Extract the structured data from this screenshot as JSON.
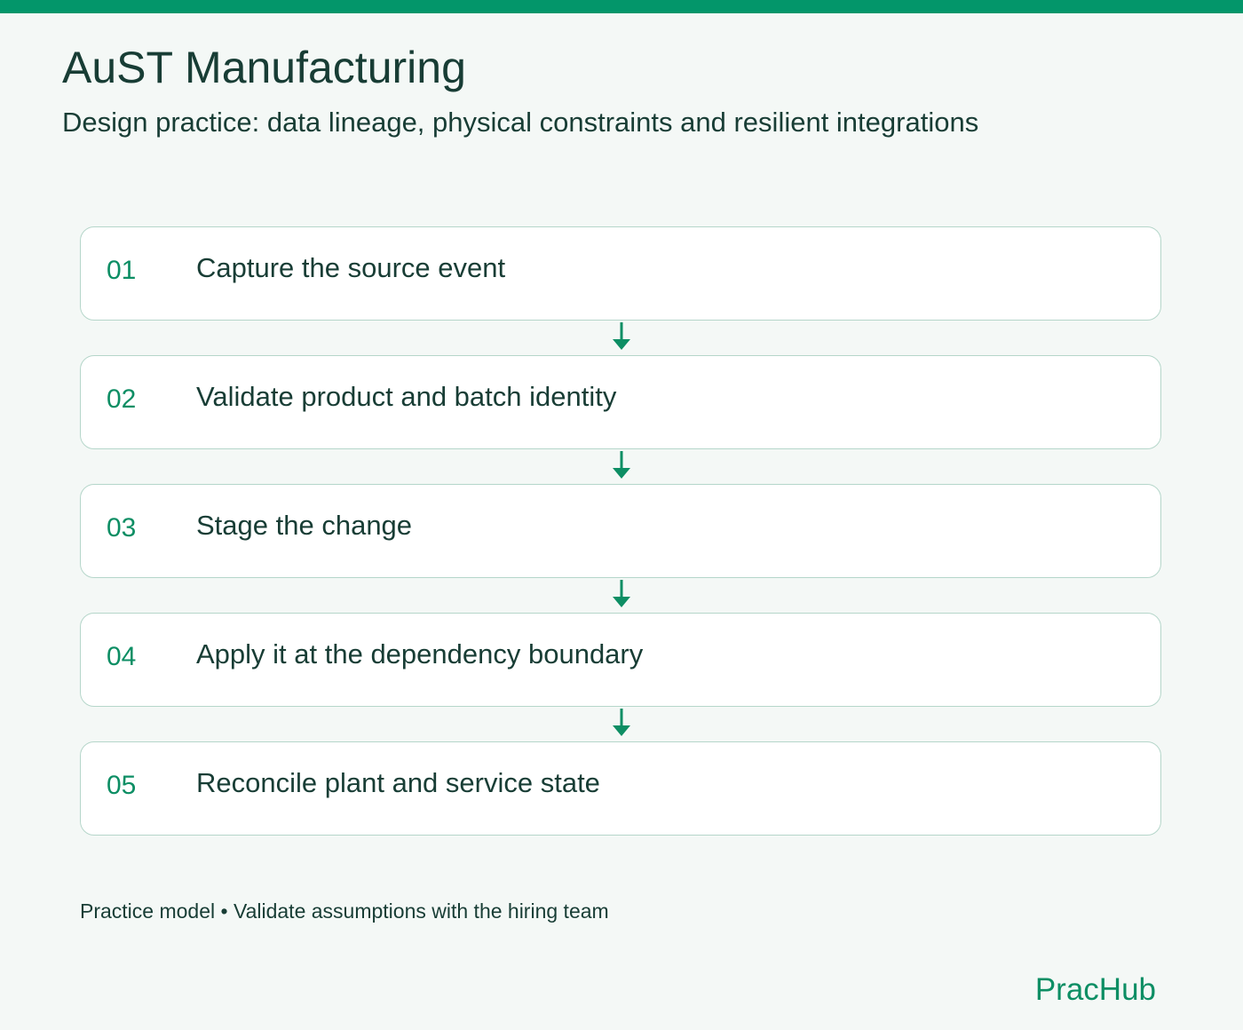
{
  "header": {
    "title": "AuST Manufacturing",
    "subtitle": "Design practice: data lineage, physical constraints and resilient integrations"
  },
  "steps": [
    {
      "number": "01",
      "label": "Capture the source event"
    },
    {
      "number": "02",
      "label": "Validate product and batch identity"
    },
    {
      "number": "03",
      "label": "Stage the change"
    },
    {
      "number": "04",
      "label": "Apply it at the dependency boundary"
    },
    {
      "number": "05",
      "label": "Reconcile plant and service state"
    }
  ],
  "footer": {
    "note": "Practice model • Validate assumptions with the hiring team",
    "brand": "PracHub"
  },
  "colors": {
    "accent": "#03966a",
    "text": "#183d35",
    "card_border": "#b5d6ca",
    "background": "#f4f8f6"
  },
  "icons": {
    "connector": "arrow-down-icon"
  }
}
